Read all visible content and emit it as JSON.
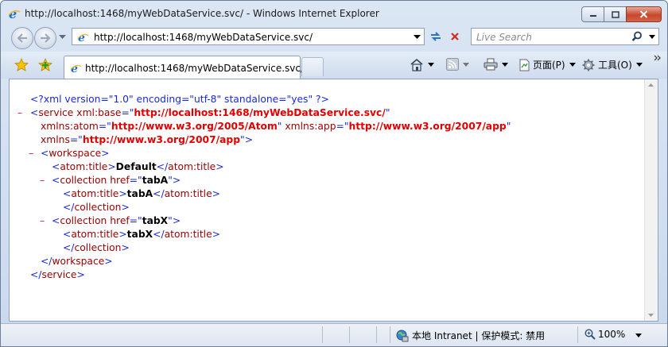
{
  "window": {
    "title": "http://localhost:1468/myWebDataService.svc/ - Windows Internet Explorer"
  },
  "address": {
    "url": "http://localhost:1468/myWebDataService.svc/"
  },
  "search": {
    "placeholder": "Live Search"
  },
  "tab": {
    "label": "http://localhost:1468/myWebDataService.svc/"
  },
  "commands": {
    "page": "页面(P)",
    "tools": "工具(O)"
  },
  "xml": {
    "decl": "<?xml version=\"1.0\" encoding=\"utf-8\" standalone=\"yes\" ?>",
    "toggle": "–",
    "open_lt": "<",
    "open_gt": ">",
    "close_lt": "</",
    "eq": "=\"",
    "quote": "\"",
    "service": {
      "tag": "service",
      "attr1": "xml:base",
      "val1": "http://localhost:1468/myWebDataService.svc/",
      "attr2": "xmlns:atom",
      "val2": "http://www.w3.org/2005/Atom",
      "attr3": "xmlns:app",
      "val3": "http://www.w3.org/2007/app",
      "attr4": "xmlns",
      "val4": "http://www.w3.org/2007/app"
    },
    "workspace_tag": "workspace",
    "atom_title_tag": "atom:title",
    "workspace_title": "Default",
    "collection_tag": "collection",
    "href_attr": "href",
    "collections": [
      {
        "href": "tabA",
        "title": "tabA"
      },
      {
        "href": "tabX",
        "title": "tabX"
      }
    ]
  },
  "status": {
    "zone": "本地 Intranet | 保护模式: 禁用",
    "zoom": "100%"
  }
}
